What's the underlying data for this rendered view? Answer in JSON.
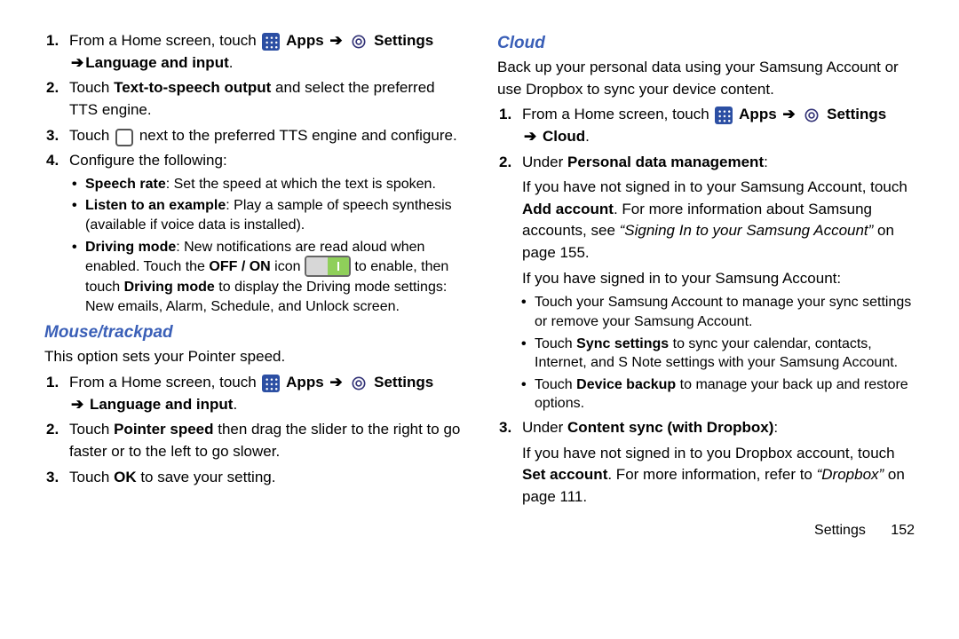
{
  "glyphs": {
    "arrow": "➔"
  },
  "left": {
    "steps": [
      {
        "num": "1",
        "pre": "From a Home screen, touch ",
        "apps": "Apps",
        "settings": "Settings",
        "line2_pre": "",
        "line2_bold": "Language and input",
        "line2_post": "."
      },
      {
        "num": "2",
        "pre": "Touch ",
        "bold1": "Text-to-speech output",
        "post": " and select the preferred TTS engine."
      },
      {
        "num": "3",
        "pre": "Touch ",
        "post": " next to the preferred TTS engine and configure."
      },
      {
        "num": "4",
        "text": "Configure the following:"
      }
    ],
    "bullets": [
      {
        "bold": "Speech rate",
        "rest": ": Set the speed at which the text is spoken."
      },
      {
        "bold": "Listen to an example",
        "rest": ": Play a sample of speech synthesis (available if voice data is installed)."
      },
      {
        "bold": "Driving mode",
        "rest1": ": New notifications are read aloud when enabled. Touch the ",
        "offon": "OFF / ON",
        "rest2": " icon ",
        "rest3": " to enable, then touch ",
        "bold2": "Driving mode",
        "rest4": " to display the Driving mode settings: New emails, Alarm, Schedule, and Unlock screen."
      }
    ],
    "mouse": {
      "title": "Mouse/trackpad",
      "intro": "This option sets your Pointer speed.",
      "steps": [
        {
          "num": "1",
          "pre": "From a Home screen, touch ",
          "apps": "Apps",
          "settings": "Settings",
          "line2_bold": " Language and input",
          "line2_post": "."
        },
        {
          "num": "2",
          "pre": "Touch ",
          "bold1": "Pointer speed",
          "post": " then drag the slider to the right to go faster or to the left to go slower."
        },
        {
          "num": "3",
          "pre": "Touch ",
          "bold1": "OK",
          "post": " to save your setting."
        }
      ]
    }
  },
  "right": {
    "title": "Cloud",
    "intro": "Back up your personal data using your Samsung Account or use Dropbox to sync your device content.",
    "steps": [
      {
        "num": "1",
        "pre": "From a Home screen, touch ",
        "apps": "Apps",
        "settings": "Settings",
        "line2_bold": " Cloud",
        "line2_post": "."
      },
      {
        "num": "2",
        "pre": "Under ",
        "bold1": "Personal data management",
        "post": ":",
        "para1_a": "If you have not signed in to your Samsung Account, touch ",
        "para1_bold": "Add account",
        "para1_b": ". For more information about Samsung accounts, see ",
        "para1_italic": "“Signing In to your Samsung Account”",
        "para1_c": " on page 155.",
        "para2": "If you have signed in to your Samsung Account:"
      },
      {
        "num": "3",
        "pre": "Under ",
        "bold1": "Content sync (with Dropbox)",
        "post": ":",
        "para1_a": "If you have not signed in to you Dropbox account, touch ",
        "para1_bold": "Set account",
        "para1_b": ". For more information, refer to ",
        "para1_italic": "“Dropbox”",
        "para1_c": " on page 111."
      }
    ],
    "bullets": [
      {
        "text": "Touch your Samsung Account to manage your sync settings or remove your Samsung Account."
      },
      {
        "pre": "Touch ",
        "bold": "Sync settings",
        "rest": " to sync your calendar, contacts, Internet, and S Note settings with your Samsung Account."
      },
      {
        "pre": "Touch ",
        "bold": "Device backup",
        "rest": " to manage your back up and restore options."
      }
    ],
    "footer_label": "Settings",
    "footer_page": "152"
  }
}
